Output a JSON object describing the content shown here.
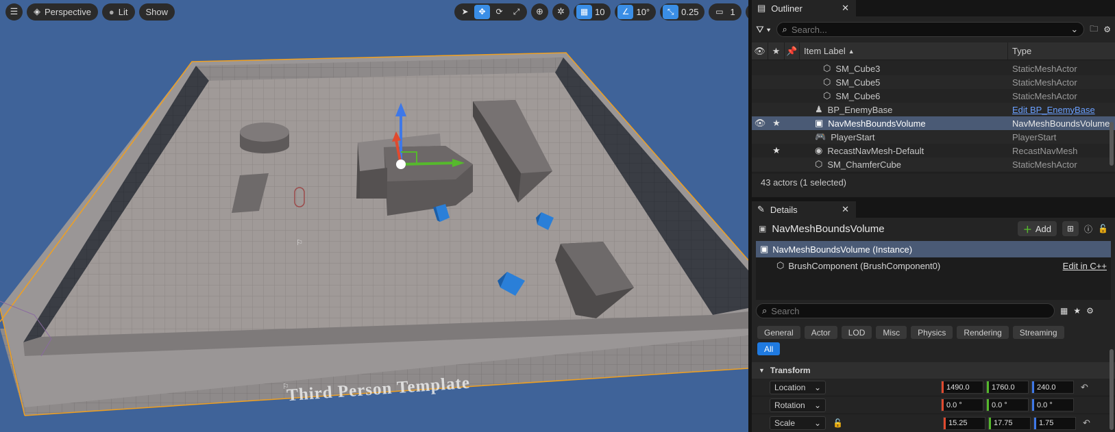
{
  "viewport": {
    "view_mode": "Perspective",
    "lighting": "Lit",
    "show": "Show",
    "grid_snap": "10",
    "rotation_snap": "10°",
    "scale_snap": "0.25",
    "camera_speed": "1",
    "watermark": "Third Person Template"
  },
  "outliner": {
    "tab_label": "Outliner",
    "search_placeholder": "Search...",
    "columns": {
      "label": "Item Label",
      "type": "Type"
    },
    "rows": [
      {
        "label": "SM_Cube3",
        "type": "StaticMeshActor",
        "eye": "",
        "star": ""
      },
      {
        "label": "SM_Cube5",
        "type": "StaticMeshActor",
        "eye": "",
        "star": ""
      },
      {
        "label": "SM_Cube6",
        "type": "StaticMeshActor",
        "eye": "",
        "star": ""
      },
      {
        "label": "BP_EnemyBase",
        "type": "Edit BP_EnemyBase",
        "eye": "",
        "star": ""
      },
      {
        "label": "NavMeshBoundsVolume",
        "type": "NavMeshBoundsVolume",
        "eye": "👁",
        "star": "★"
      },
      {
        "label": "PlayerStart",
        "type": "PlayerStart",
        "eye": "",
        "star": ""
      },
      {
        "label": "RecastNavMesh-Default",
        "type": "RecastNavMesh",
        "eye": "",
        "star": "★"
      },
      {
        "label": "SM_ChamferCube",
        "type": "StaticMeshActor",
        "eye": "",
        "star": ""
      }
    ],
    "footer": "43 actors (1 selected)"
  },
  "details": {
    "tab_label": "Details",
    "title": "NavMeshBoundsVolume",
    "add_label": "Add",
    "components": [
      {
        "label": "NavMeshBoundsVolume (Instance)",
        "link": ""
      },
      {
        "label": "BrushComponent (BrushComponent0)",
        "link": "Edit in C++"
      }
    ],
    "search_placeholder": "Search",
    "filters": [
      "General",
      "Actor",
      "LOD",
      "Misc",
      "Physics",
      "Rendering",
      "Streaming",
      "All"
    ],
    "transform": {
      "header": "Transform",
      "location": {
        "label": "Location",
        "x": "1490.0",
        "y": "1760.0",
        "z": "240.0"
      },
      "rotation": {
        "label": "Rotation",
        "x": "0.0 °",
        "y": "0.0 °",
        "z": "0.0 °"
      },
      "scale": {
        "label": "Scale",
        "x": "15.25",
        "y": "17.75",
        "z": "1.75"
      }
    }
  },
  "colors": {
    "accent": "#3a8ee6",
    "selection": "#4a5a75",
    "axis_x": "#e04a2f",
    "axis_y": "#56b92c",
    "axis_z": "#3e78e8",
    "viewport_bg": "#3f6399"
  }
}
